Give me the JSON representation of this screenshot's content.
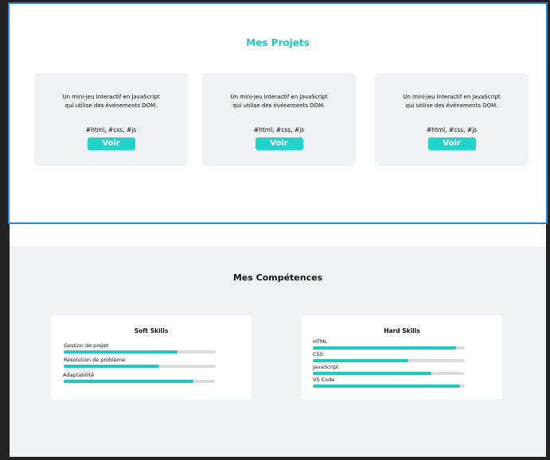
{
  "projects": {
    "title": "Mes Projets",
    "cards": [
      {
        "desc_line1": "Un mini-jeu interactif en JavaScript",
        "desc_line2": "qui utilise des événements DOM.",
        "tags": "#html, #css, #js",
        "button": "Voir"
      },
      {
        "desc_line1": "Un mini-jeu interactif en JavaScript",
        "desc_line2": "qui utilise des événements DOM.",
        "tags": "#html, #css, #js",
        "button": "Voir"
      },
      {
        "desc_line1": "Un mini-jeu interactif en JavaScript",
        "desc_line2": "qui utilise des événements DOM.",
        "tags": "#html, #css, #js",
        "button": "Voir"
      }
    ]
  },
  "skills": {
    "title": "Mes Compétences",
    "soft": {
      "title": "Soft Skills",
      "items": [
        {
          "label": "Gestion de projet",
          "level": 0.75
        },
        {
          "label": "Résolution de problème",
          "level": 0.63
        },
        {
          "label": "Adaptabilité",
          "level": 0.86
        }
      ]
    },
    "hard": {
      "title": "Hard Skills",
      "items": [
        {
          "label": "HTML",
          "level": 0.94
        },
        {
          "label": "CSS",
          "level": 0.63
        },
        {
          "label": "JavaScript",
          "level": 0.78
        },
        {
          "label": "VS Code",
          "level": 0.97
        }
      ]
    }
  },
  "colors": {
    "accent": "#22c7c1",
    "button": "#22d3c9",
    "selection": "#2a86d9"
  }
}
